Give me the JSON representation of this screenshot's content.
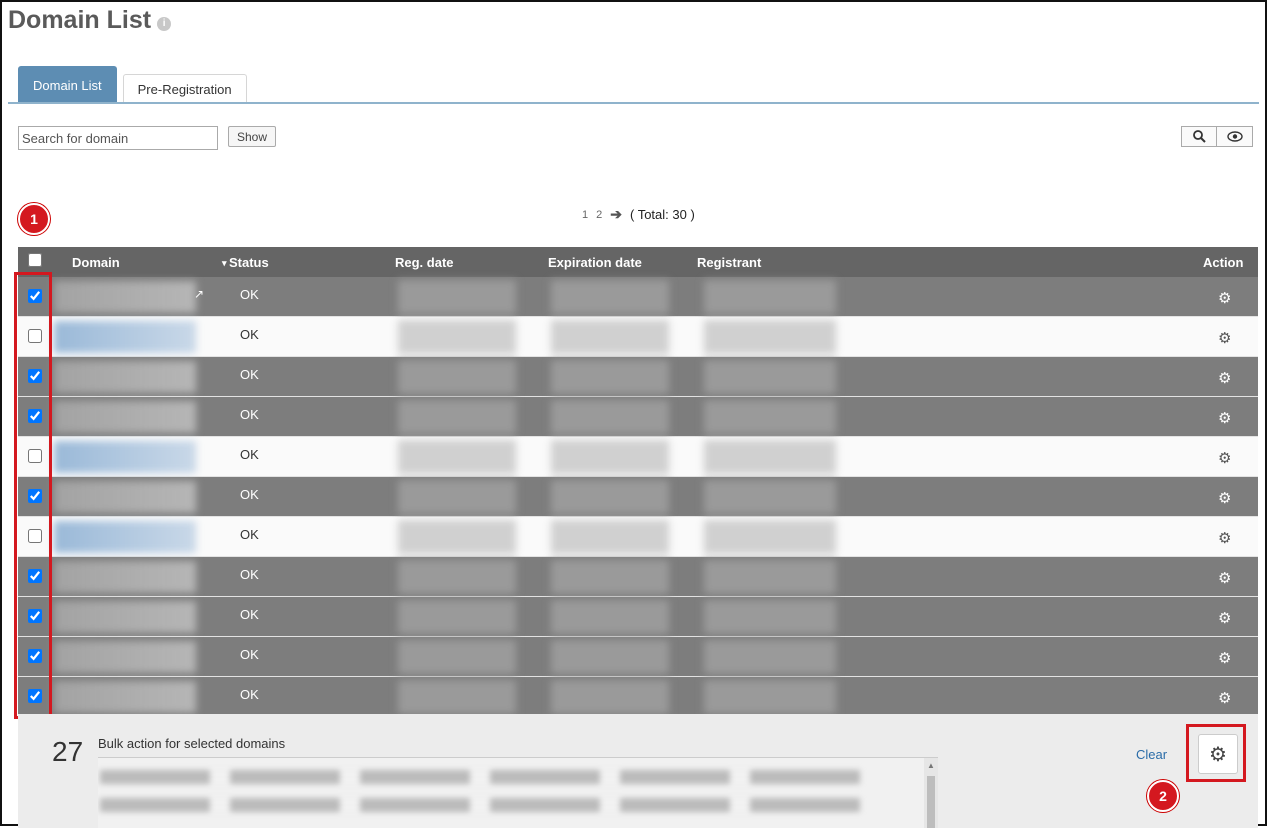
{
  "page": {
    "title": "Domain List"
  },
  "tabs": [
    {
      "label": "Domain List",
      "active": true
    },
    {
      "label": "Pre-Registration",
      "active": false
    }
  ],
  "search": {
    "placeholder": "Search for domain",
    "show_label": "Show"
  },
  "toolbar": {
    "search_icon": "⚲",
    "view_icon": "👁"
  },
  "pagination": {
    "pages": [
      "1",
      "2"
    ],
    "next_icon": "➔",
    "total": "( Total: 30 )"
  },
  "annotations": {
    "badge1": "1",
    "badge2": "2"
  },
  "table": {
    "headers": {
      "domain": "Domain",
      "status": "Status",
      "reg_date": "Reg. date",
      "expiration": "Expiration date",
      "registrant": "Registrant",
      "action": "Action"
    },
    "sort_icon": "▾",
    "rows": [
      {
        "selected": true,
        "status": "OK"
      },
      {
        "selected": false,
        "status": "OK"
      },
      {
        "selected": true,
        "status": "OK"
      },
      {
        "selected": true,
        "status": "OK"
      },
      {
        "selected": false,
        "status": "OK"
      },
      {
        "selected": true,
        "status": "OK"
      },
      {
        "selected": false,
        "status": "OK"
      },
      {
        "selected": true,
        "status": "OK"
      },
      {
        "selected": true,
        "status": "OK"
      },
      {
        "selected": true,
        "status": "OK"
      },
      {
        "selected": true,
        "status": "OK"
      }
    ]
  },
  "bulk": {
    "count": "27",
    "label": "Bulk action for selected domains",
    "clear": "Clear"
  },
  "icons": {
    "gear": "⚙",
    "external": "↗"
  },
  "colors": {
    "tab_active": "#5d8db3",
    "selected_row": "#7d7d7d",
    "header": "#656565",
    "badge": "#d4181f",
    "link": "#2a6ca8"
  }
}
